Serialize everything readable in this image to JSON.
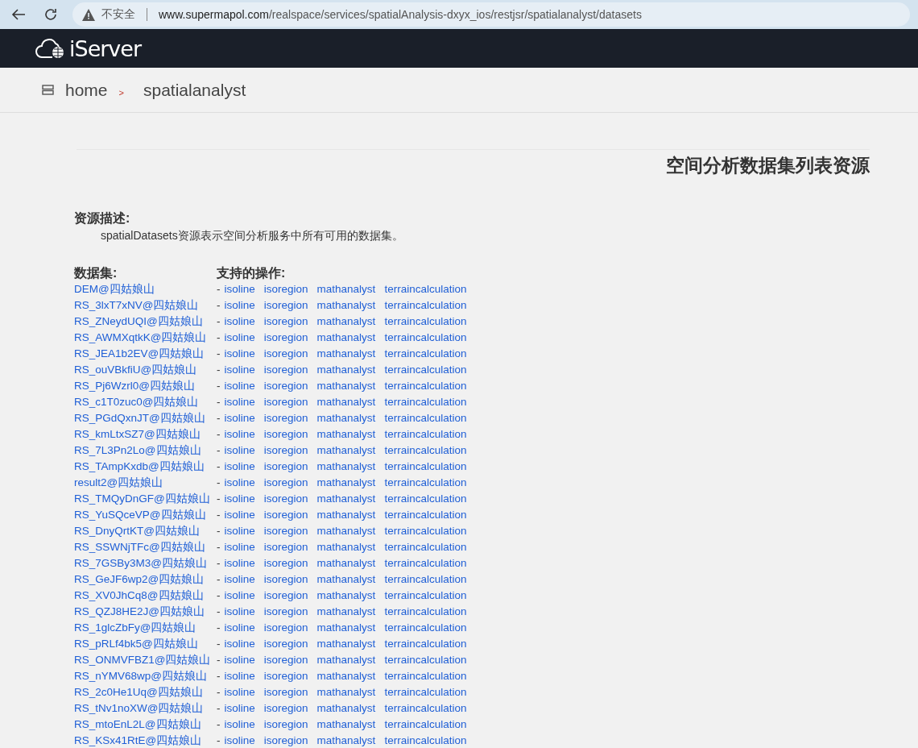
{
  "browser": {
    "security_label": "不安全",
    "url_host": "www.supermapol.com",
    "url_path": "/realspace/services/spatialAnalysis-dxyx_ios/restjsr/spatialanalyst/datasets"
  },
  "header": {
    "logo": "iServer"
  },
  "breadcrumb": {
    "items": [
      "home",
      "spatialanalyst"
    ],
    "separator": ">"
  },
  "page_title": "空间分析数据集列表资源",
  "description": {
    "heading": "资源描述:",
    "text": "spatialDatasets资源表示空间分析服务中所有可用的数据集。"
  },
  "table": {
    "columns": [
      "数据集:",
      "支持的操作:"
    ],
    "dash": "-",
    "rows": [
      {
        "dataset": "DEM@四姑娘山",
        "operations": [
          "isoline",
          "isoregion",
          "mathanalyst",
          "terraincalculation"
        ]
      },
      {
        "dataset": "RS_3lxT7xNV@四姑娘山",
        "operations": [
          "isoline",
          "isoregion",
          "mathanalyst",
          "terraincalculation"
        ]
      },
      {
        "dataset": "RS_ZNeydUQI@四姑娘山",
        "operations": [
          "isoline",
          "isoregion",
          "mathanalyst",
          "terraincalculation"
        ]
      },
      {
        "dataset": "RS_AWMXqtkK@四姑娘山",
        "operations": [
          "isoline",
          "isoregion",
          "mathanalyst",
          "terraincalculation"
        ]
      },
      {
        "dataset": "RS_JEA1b2EV@四姑娘山",
        "operations": [
          "isoline",
          "isoregion",
          "mathanalyst",
          "terraincalculation"
        ]
      },
      {
        "dataset": "RS_ouVBkfiU@四姑娘山",
        "operations": [
          "isoline",
          "isoregion",
          "mathanalyst",
          "terraincalculation"
        ]
      },
      {
        "dataset": "RS_Pj6Wzrl0@四姑娘山",
        "operations": [
          "isoline",
          "isoregion",
          "mathanalyst",
          "terraincalculation"
        ]
      },
      {
        "dataset": "RS_c1T0zuc0@四姑娘山",
        "operations": [
          "isoline",
          "isoregion",
          "mathanalyst",
          "terraincalculation"
        ]
      },
      {
        "dataset": "RS_PGdQxnJT@四姑娘山",
        "operations": [
          "isoline",
          "isoregion",
          "mathanalyst",
          "terraincalculation"
        ]
      },
      {
        "dataset": "RS_kmLtxSZ7@四姑娘山",
        "operations": [
          "isoline",
          "isoregion",
          "mathanalyst",
          "terraincalculation"
        ]
      },
      {
        "dataset": "RS_7L3Pn2Lo@四姑娘山",
        "operations": [
          "isoline",
          "isoregion",
          "mathanalyst",
          "terraincalculation"
        ]
      },
      {
        "dataset": "RS_TAmpKxdb@四姑娘山",
        "operations": [
          "isoline",
          "isoregion",
          "mathanalyst",
          "terraincalculation"
        ]
      },
      {
        "dataset": "result2@四姑娘山",
        "operations": [
          "isoline",
          "isoregion",
          "mathanalyst",
          "terraincalculation"
        ]
      },
      {
        "dataset": "RS_TMQyDnGF@四姑娘山",
        "operations": [
          "isoline",
          "isoregion",
          "mathanalyst",
          "terraincalculation"
        ]
      },
      {
        "dataset": "RS_YuSQceVP@四姑娘山",
        "operations": [
          "isoline",
          "isoregion",
          "mathanalyst",
          "terraincalculation"
        ]
      },
      {
        "dataset": "RS_DnyQrtKT@四姑娘山",
        "operations": [
          "isoline",
          "isoregion",
          "mathanalyst",
          "terraincalculation"
        ]
      },
      {
        "dataset": "RS_SSWNjTFc@四姑娘山",
        "operations": [
          "isoline",
          "isoregion",
          "mathanalyst",
          "terraincalculation"
        ]
      },
      {
        "dataset": "RS_7GSBy3M3@四姑娘山",
        "operations": [
          "isoline",
          "isoregion",
          "mathanalyst",
          "terraincalculation"
        ]
      },
      {
        "dataset": "RS_GeJF6wp2@四姑娘山",
        "operations": [
          "isoline",
          "isoregion",
          "mathanalyst",
          "terraincalculation"
        ]
      },
      {
        "dataset": "RS_XV0JhCq8@四姑娘山",
        "operations": [
          "isoline",
          "isoregion",
          "mathanalyst",
          "terraincalculation"
        ]
      },
      {
        "dataset": "RS_QZJ8HE2J@四姑娘山",
        "operations": [
          "isoline",
          "isoregion",
          "mathanalyst",
          "terraincalculation"
        ]
      },
      {
        "dataset": "RS_1glcZbFy@四姑娘山",
        "operations": [
          "isoline",
          "isoregion",
          "mathanalyst",
          "terraincalculation"
        ]
      },
      {
        "dataset": "RS_pRLf4bk5@四姑娘山",
        "operations": [
          "isoline",
          "isoregion",
          "mathanalyst",
          "terraincalculation"
        ]
      },
      {
        "dataset": "RS_ONMVFBZ1@四姑娘山",
        "operations": [
          "isoline",
          "isoregion",
          "mathanalyst",
          "terraincalculation"
        ]
      },
      {
        "dataset": "RS_nYMV68wp@四姑娘山",
        "operations": [
          "isoline",
          "isoregion",
          "mathanalyst",
          "terraincalculation"
        ]
      },
      {
        "dataset": "RS_2c0He1Uq@四姑娘山",
        "operations": [
          "isoline",
          "isoregion",
          "mathanalyst",
          "terraincalculation"
        ]
      },
      {
        "dataset": "RS_tNv1noXW@四姑娘山",
        "operations": [
          "isoline",
          "isoregion",
          "mathanalyst",
          "terraincalculation"
        ]
      },
      {
        "dataset": "RS_mtoEnL2L@四姑娘山",
        "operations": [
          "isoline",
          "isoregion",
          "mathanalyst",
          "terraincalculation"
        ]
      },
      {
        "dataset": "RS_KSx41RtE@四姑娘山",
        "operations": [
          "isoline",
          "isoregion",
          "mathanalyst",
          "terraincalculation"
        ]
      }
    ]
  }
}
